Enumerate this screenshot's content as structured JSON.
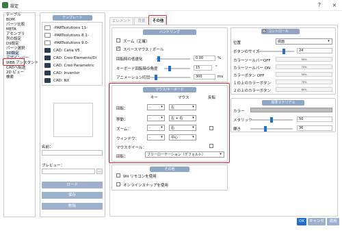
{
  "window": {
    "title": "設定",
    "help": "?",
    "close": "×"
  },
  "sidebar": {
    "items": [
      "テーブル",
      "BOM",
      "パーツ比較",
      "META",
      "アセンブリ",
      "列の設定",
      "D9設定",
      "パーツ選択",
      "3D設定",
      "デザインバー",
      "WEB アシスタント",
      "CADへ転送",
      "2D ビュー",
      "検索"
    ],
    "selected_index": 8
  },
  "template": {
    "header": "テンプレート",
    "items": [
      {
        "label": "-PARTsolutions 11-",
        "icon": "doc"
      },
      {
        "label": "-PARTsolutions 8.1-",
        "icon": "doc"
      },
      {
        "label": "-PARTsolutions 9.0-",
        "icon": "doc"
      },
      {
        "label": "CAD: Catia V5",
        "icon": "dark"
      },
      {
        "label": "CAD: Creo Elements/Di",
        "icon": "dark"
      },
      {
        "label": "CAD: Creo Parametric",
        "icon": "dark"
      },
      {
        "label": "CAD: Inventor",
        "icon": "dark"
      },
      {
        "label": "CAD: NX",
        "icon": "dark"
      }
    ],
    "name_label": "名前：",
    "preview_label": "プレビュー：",
    "browse_label": "…",
    "load_button": "ロード",
    "save_button": "保存",
    "delete_button": "削除"
  },
  "tabs": [
    {
      "label": "エレメント",
      "active": false
    },
    {
      "label": "背景",
      "active": false
    },
    {
      "label": "その他",
      "active": true
    }
  ],
  "handling": {
    "header": "ハンドリング",
    "zoom_label": "ズーム（正確）",
    "zoom_checked": false,
    "spacemouse_label": "スペースマウス / ボール",
    "spacemouse_checked": true,
    "rot_speed_label": "回転時の低速化",
    "rot_speed_value": "0.00",
    "rot_speed_unit": "%",
    "rot_speed_level": 0.08,
    "key_angle_label": "キーボード回転時の角度",
    "key_angle_value": "15",
    "key_angle_unit": "°",
    "key_angle_level": 0.22,
    "anim_label": "アニメーション時間",
    "anim_value": "300",
    "anim_unit": "ms",
    "anim_level": 0.27
  },
  "mouse_kb": {
    "header": "マウス/キーボード",
    "col_key": "キー",
    "col_mouse": "マウス",
    "col_invert": "反転",
    "rows": [
      {
        "label": "回転：",
        "key": "-",
        "mouse": "左",
        "has_invert": false
      },
      {
        "label": "移動：",
        "key": "-",
        "mouse": "左 + 右",
        "has_invert": false
      },
      {
        "label": "ズーム：",
        "key": "-",
        "mouse": "右",
        "has_invert": true
      },
      {
        "label": "ウィンドウ：",
        "key": "-",
        "mouse": "中心",
        "has_invert": false
      }
    ],
    "wheel_label": "マウスホイール：",
    "rotation_label": "回転：",
    "rotation_value": "フリーローテーション（デフォルト）"
  },
  "other": {
    "header": "その他",
    "wii_label": "Wii リモコンを使用",
    "wii_checked": false,
    "snap_label": "オンラインスナップを使用",
    "snap_checked": false
  },
  "control": {
    "header": "コントロール",
    "header_checked": true,
    "position_label": "位置",
    "position_value": "底面",
    "btnsize_label": "ボタンのサイズ",
    "btnsize_value": "24",
    "btnsize_level": 0.72,
    "bars": [
      {
        "label": "カラーツールバーOFF",
        "value": "50%"
      },
      {
        "label": "カラーツールバー ON",
        "value": "70%"
      },
      {
        "label": "カラーボタン OFF",
        "value": "50%"
      },
      {
        "label": "１の上のカラーボタン",
        "value": "70%"
      },
      {
        "label": "２の上のカラーボタン",
        "value": "80%"
      }
    ]
  },
  "std_material": {
    "header": "標準マテリアル",
    "color_label": "カラー",
    "color_swatch": "#bdbdbd",
    "metallic_label": "メタリック",
    "metallic_value": "50",
    "metallic_level": 0.5,
    "brightness_label": "輝き",
    "brightness_value": "36",
    "brightness_level": 0.36
  },
  "footer": {
    "ok": "OK",
    "cancel": "キャンセル",
    "apply": "適用"
  },
  "colors": {
    "accent": "#1e6fd0",
    "header": "#8fa6c5",
    "button": "#9db1cd",
    "highlight": "#e0242a"
  }
}
